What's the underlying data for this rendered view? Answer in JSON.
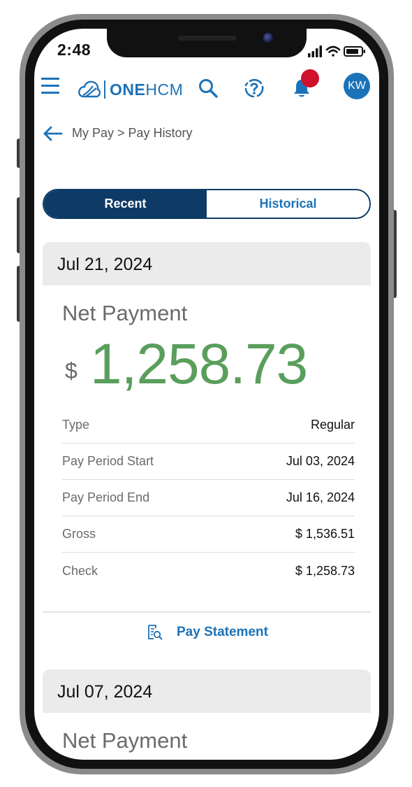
{
  "status_bar": {
    "time": "2:48"
  },
  "header": {
    "logo_text_bold": "ONE",
    "logo_text_regular": "HCM",
    "avatar_initials": "KW",
    "icons": [
      "menu-icon",
      "search-icon",
      "help-icon",
      "bell-icon"
    ],
    "badge_color": "#d0112b"
  },
  "breadcrumb": {
    "text": "My Pay > Pay History"
  },
  "tabs": [
    {
      "label": "Recent",
      "selected": true
    },
    {
      "label": "Historical",
      "selected": false
    }
  ],
  "payments": [
    {
      "date": "Jul 21, 2024",
      "net_label": "Net Payment",
      "currency": "$",
      "amount": "1,258.73",
      "details": [
        {
          "label": "Type",
          "value": "Regular"
        },
        {
          "label": "Pay Period Start",
          "value": "Jul 03, 2024"
        },
        {
          "label": "Pay Period End",
          "value": "Jul 16, 2024"
        },
        {
          "label": "Gross",
          "value": "$ 1,536.51"
        },
        {
          "label": "Check",
          "value": "$ 1,258.73"
        }
      ],
      "action_label": "Pay Statement"
    },
    {
      "date": "Jul 07, 2024",
      "net_label": "Net Payment"
    }
  ],
  "colors": {
    "brand_blue": "#1c72b8",
    "navy": "#0e3a66",
    "amount_green": "#5a9e5c",
    "card_header_gray": "#ebebeb"
  }
}
